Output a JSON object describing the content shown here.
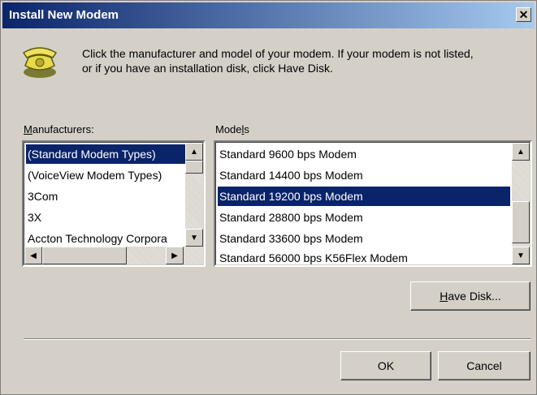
{
  "window": {
    "title": "Install New Modem",
    "close_label": "✕"
  },
  "instructions": {
    "line1": "Click the manufacturer and model of your modem. If your modem is not listed,",
    "line2": "or if you have an installation disk, click Have Disk."
  },
  "manufacturers": {
    "label_prefix": "",
    "label_access": "M",
    "label_rest": "anufacturers:",
    "items": [
      {
        "label": "(Standard Modem Types)",
        "selected": true
      },
      {
        "label": "(VoiceView Modem Types)",
        "selected": false
      },
      {
        "label": "3Com",
        "selected": false
      },
      {
        "label": "3X",
        "selected": false
      },
      {
        "label": "Accton Technology Corpora",
        "selected": false
      }
    ]
  },
  "models": {
    "label_prefix": "Mode",
    "label_access": "l",
    "label_rest": "s",
    "items": [
      {
        "label": "Standard  9600 bps Modem",
        "selected": false
      },
      {
        "label": "Standard 14400 bps Modem",
        "selected": false
      },
      {
        "label": "Standard 19200 bps Modem",
        "selected": true
      },
      {
        "label": "Standard 28800 bps Modem",
        "selected": false
      },
      {
        "label": "Standard 33600 bps Modem",
        "selected": false
      },
      {
        "label": "Standard 56000 bps K56Flex Modem",
        "selected": false
      }
    ]
  },
  "buttons": {
    "have_disk_access": "H",
    "have_disk_rest": "ave Disk...",
    "ok": "OK",
    "cancel": "Cancel"
  },
  "colors": {
    "title_start": "#0a246a",
    "title_end": "#a6caf0",
    "selection": "#0a246a",
    "face": "#d4d0c8"
  }
}
